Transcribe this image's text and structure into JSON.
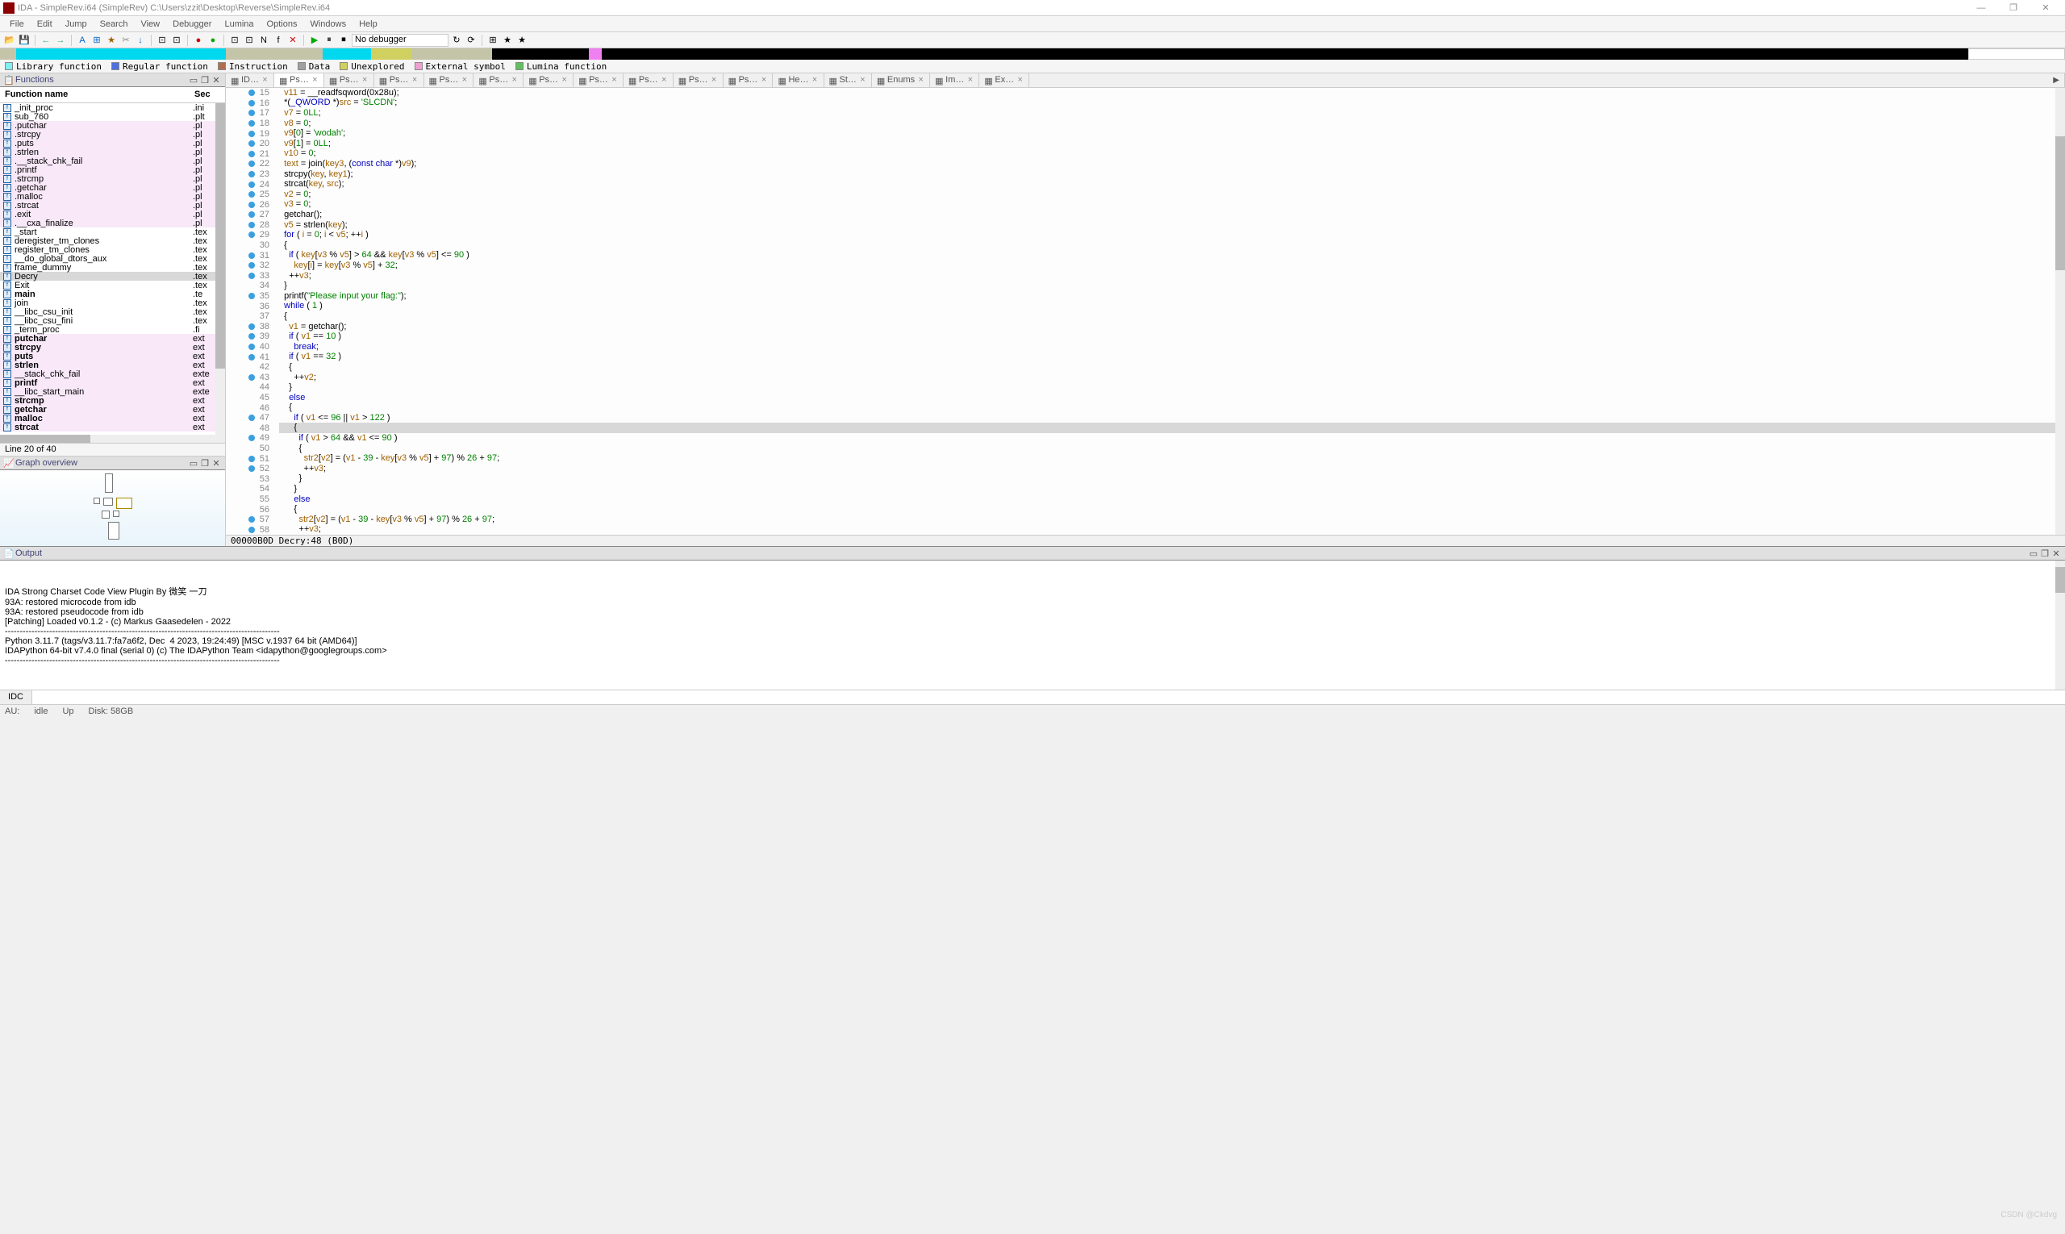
{
  "window": {
    "title": "IDA - SimpleRev.i64 (SimpleRev) C:\\Users\\zzit\\Desktop\\Reverse\\SimpleRev.i64",
    "min": "—",
    "max": "❐",
    "close": "✕"
  },
  "menu": [
    "File",
    "Edit",
    "Jump",
    "Search",
    "View",
    "Debugger",
    "Lumina",
    "Options",
    "Windows",
    "Help"
  ],
  "toolbar": {
    "debugger": "No debugger"
  },
  "legend": [
    {
      "color": "#80f0f0",
      "label": "Library function"
    },
    {
      "color": "#5070e0",
      "label": "Regular function"
    },
    {
      "color": "#b07050",
      "label": "Instruction"
    },
    {
      "color": "#a0a0a0",
      "label": "Data"
    },
    {
      "color": "#d0d060",
      "label": "Unexplored"
    },
    {
      "color": "#f0a0d0",
      "label": "External symbol"
    },
    {
      "color": "#60c060",
      "label": "Lumina function"
    }
  ],
  "functions": {
    "panel_title": "Functions",
    "col1": "Function name",
    "col2": "Sec",
    "items": [
      {
        "n": "_init_proc",
        "s": ".ini",
        "t": "f",
        "pink": false
      },
      {
        "n": "sub_760",
        "s": ".plt",
        "t": "f",
        "pink": false
      },
      {
        "n": ".putchar",
        "s": ".pl",
        "t": "f",
        "pink": true
      },
      {
        "n": ".strcpy",
        "s": ".pl",
        "t": "f",
        "pink": true
      },
      {
        "n": ".puts",
        "s": ".pl",
        "t": "f",
        "pink": true
      },
      {
        "n": ".strlen",
        "s": ".pl",
        "t": "f",
        "pink": true
      },
      {
        "n": ".__stack_chk_fail",
        "s": ".pl",
        "t": "f",
        "pink": true
      },
      {
        "n": ".printf",
        "s": ".pl",
        "t": "f",
        "pink": true
      },
      {
        "n": ".strcmp",
        "s": ".pl",
        "t": "f",
        "pink": true
      },
      {
        "n": ".getchar",
        "s": ".pl",
        "t": "f",
        "pink": true
      },
      {
        "n": ".malloc",
        "s": ".pl",
        "t": "f",
        "pink": true
      },
      {
        "n": ".strcat",
        "s": ".pl",
        "t": "f",
        "pink": true
      },
      {
        "n": ".exit",
        "s": ".pl",
        "t": "f",
        "pink": true
      },
      {
        "n": ".__cxa_finalize",
        "s": ".pl",
        "t": "f",
        "pink": true
      },
      {
        "n": "_start",
        "s": ".tex",
        "t": "f",
        "pink": false
      },
      {
        "n": "deregister_tm_clones",
        "s": ".tex",
        "t": "f",
        "pink": false
      },
      {
        "n": "register_tm_clones",
        "s": ".tex",
        "t": "f",
        "pink": false
      },
      {
        "n": "__do_global_dtors_aux",
        "s": ".tex",
        "t": "f",
        "pink": false
      },
      {
        "n": "frame_dummy",
        "s": ".tex",
        "t": "f",
        "pink": false
      },
      {
        "n": "Decry",
        "s": ".tex",
        "t": "f",
        "pink": false,
        "sel": true
      },
      {
        "n": "Exit",
        "s": ".tex",
        "t": "f",
        "pink": false
      },
      {
        "n": "main",
        "s": ".te",
        "t": "f",
        "pink": false,
        "bold": true
      },
      {
        "n": "join",
        "s": ".tex",
        "t": "f",
        "pink": false
      },
      {
        "n": "__libc_csu_init",
        "s": ".tex",
        "t": "f",
        "pink": false
      },
      {
        "n": "__libc_csu_fini",
        "s": ".tex",
        "t": "f",
        "pink": false
      },
      {
        "n": "_term_proc",
        "s": ".fi",
        "t": "f",
        "pink": false
      },
      {
        "n": "putchar",
        "s": "ext",
        "t": "f",
        "pink": true,
        "bold": true
      },
      {
        "n": "strcpy",
        "s": "ext",
        "t": "f",
        "pink": true,
        "bold": true
      },
      {
        "n": "puts",
        "s": "ext",
        "t": "f",
        "pink": true,
        "bold": true
      },
      {
        "n": "strlen",
        "s": "ext",
        "t": "f",
        "pink": true,
        "bold": true
      },
      {
        "n": "__stack_chk_fail",
        "s": "exte",
        "t": "f",
        "pink": true
      },
      {
        "n": "printf",
        "s": "ext",
        "t": "f",
        "pink": true,
        "bold": true
      },
      {
        "n": "__libc_start_main",
        "s": "exte",
        "t": "f",
        "pink": true
      },
      {
        "n": "strcmp",
        "s": "ext",
        "t": "f",
        "pink": true,
        "bold": true
      },
      {
        "n": "getchar",
        "s": "ext",
        "t": "f",
        "pink": true,
        "bold": true
      },
      {
        "n": "malloc",
        "s": "ext",
        "t": "f",
        "pink": true,
        "bold": true
      },
      {
        "n": "strcat",
        "s": "ext",
        "t": "f",
        "pink": true,
        "bold": true
      }
    ],
    "status": "Line 20 of 40"
  },
  "graph": {
    "panel_title": "Graph overview"
  },
  "tabs": [
    {
      "label": "ID…"
    },
    {
      "label": "Ps…",
      "active": true
    },
    {
      "label": "Ps…"
    },
    {
      "label": "Ps…"
    },
    {
      "label": "Ps…"
    },
    {
      "label": "Ps…"
    },
    {
      "label": "Ps…"
    },
    {
      "label": "Ps…"
    },
    {
      "label": "Ps…"
    },
    {
      "label": "Ps…"
    },
    {
      "label": "Ps…"
    },
    {
      "label": "He…"
    },
    {
      "label": "St…"
    },
    {
      "label": "Enums"
    },
    {
      "label": "Im…"
    },
    {
      "label": "Ex…"
    }
  ],
  "code": {
    "start": 15,
    "lines": [
      {
        "dot": true,
        "t": "  v11 = __readfsqword(0x28u);"
      },
      {
        "dot": true,
        "t": "  *(_QWORD *)src = 'SLCDN';"
      },
      {
        "dot": true,
        "t": "  v7 = 0LL;"
      },
      {
        "dot": true,
        "t": "  v8 = 0;"
      },
      {
        "dot": true,
        "t": "  v9[0] = 'wodah';"
      },
      {
        "dot": true,
        "t": "  v9[1] = 0LL;"
      },
      {
        "dot": true,
        "t": "  v10 = 0;"
      },
      {
        "dot": true,
        "t": "  text = join(key3, (const char *)v9);"
      },
      {
        "dot": true,
        "t": "  strcpy(key, key1);"
      },
      {
        "dot": true,
        "t": "  strcat(key, src);"
      },
      {
        "dot": true,
        "t": "  v2 = 0;"
      },
      {
        "dot": true,
        "t": "  v3 = 0;"
      },
      {
        "dot": true,
        "t": "  getchar();"
      },
      {
        "dot": true,
        "t": "  v5 = strlen(key);"
      },
      {
        "dot": true,
        "t": "  for ( i = 0; i < v5; ++i )"
      },
      {
        "dot": false,
        "t": "  {"
      },
      {
        "dot": true,
        "t": "    if ( key[v3 % v5] > 64 && key[v3 % v5] <= 90 )"
      },
      {
        "dot": true,
        "t": "      key[i] = key[v3 % v5] + 32;"
      },
      {
        "dot": true,
        "t": "    ++v3;"
      },
      {
        "dot": false,
        "t": "  }"
      },
      {
        "dot": true,
        "t": "  printf(\"Please input your flag:\");"
      },
      {
        "dot": false,
        "t": "  while ( 1 )"
      },
      {
        "dot": false,
        "t": "  {"
      },
      {
        "dot": true,
        "t": "    v1 = getchar();"
      },
      {
        "dot": true,
        "t": "    if ( v1 == 10 )"
      },
      {
        "dot": true,
        "t": "      break;"
      },
      {
        "dot": true,
        "t": "    if ( v1 == 32 )"
      },
      {
        "dot": false,
        "t": "    {"
      },
      {
        "dot": true,
        "t": "      ++v2;"
      },
      {
        "dot": false,
        "t": "    }"
      },
      {
        "dot": false,
        "t": "    else"
      },
      {
        "dot": false,
        "t": "    {"
      },
      {
        "dot": true,
        "t": "      if ( v1 <= 96 || v1 > 122 )"
      },
      {
        "dot": false,
        "t": "      {",
        "sel": true
      },
      {
        "dot": true,
        "t": "        if ( v1 > 64 && v1 <= 90 )"
      },
      {
        "dot": false,
        "t": "        {"
      },
      {
        "dot": true,
        "t": "          str2[v2] = (v1 - 39 - key[v3 % v5] + 97) % 26 + 97;"
      },
      {
        "dot": true,
        "t": "          ++v3;"
      },
      {
        "dot": false,
        "t": "        }"
      },
      {
        "dot": false,
        "t": "      }"
      },
      {
        "dot": false,
        "t": "      else"
      },
      {
        "dot": false,
        "t": "      {"
      },
      {
        "dot": true,
        "t": "        str2[v2] = (v1 - 39 - key[v3 % v5] + 97) % 26 + 97;"
      },
      {
        "dot": true,
        "t": "        ++v3;"
      }
    ],
    "status": "00000B0D Decry:48 (B0D)"
  },
  "output": {
    "panel_title": "Output",
    "lines": [
      "IDA Strong Charset Code View Plugin By 微笑 一刀",
      "",
      "93A: restored microcode from idb",
      "93A: restored pseudocode from idb",
      "[Patching] Loaded v0.1.2 - (c) Markus Gaasedelen - 2022",
      "---------------------------------------------------------------------------------------------",
      "Python 3.11.7 (tags/v3.11.7:fa7a6f2, Dec  4 2023, 19:24:49) [MSC v.1937 64 bit (AMD64)]",
      "IDAPython 64-bit v7.4.0 final (serial 0) (c) The IDAPython Team <idapython@googlegroups.com>",
      "---------------------------------------------------------------------------------------------"
    ],
    "idc_label": "IDC"
  },
  "statusbar": {
    "au": "AU:",
    "idle": "idle",
    "up": "Up",
    "disk": "Disk: 58GB"
  },
  "watermark": "CSDN @Ckdvg"
}
